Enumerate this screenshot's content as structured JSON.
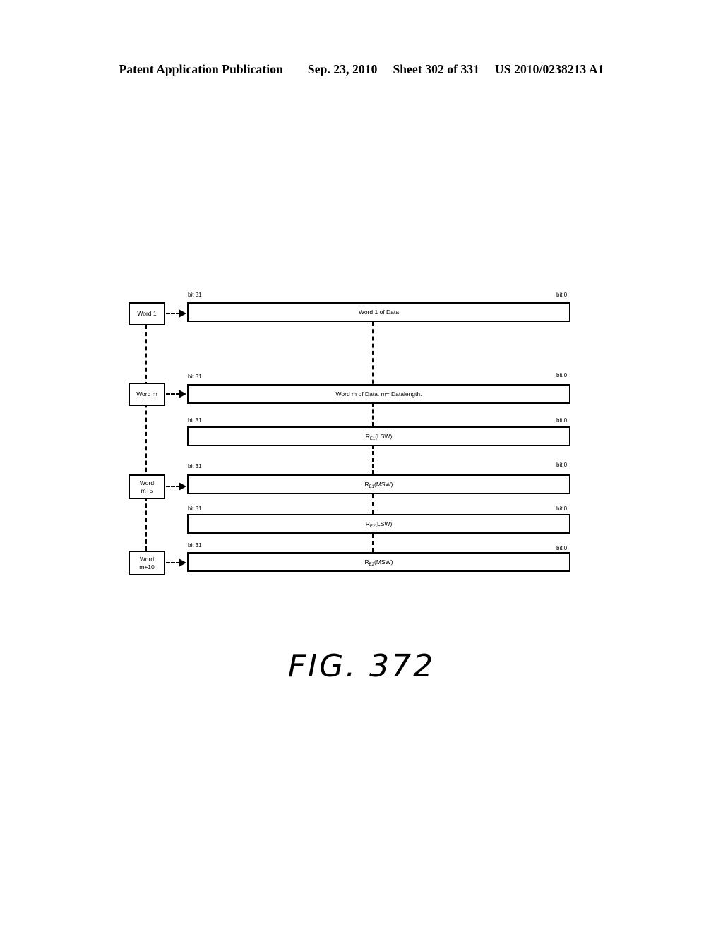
{
  "header": {
    "publication": "Patent Application Publication",
    "date": "Sep. 23, 2010",
    "sheet": "Sheet 302 of 331",
    "patent_number": "US 2010/0238213 A1"
  },
  "figure": {
    "caption": "FIG. 372",
    "bit_label_left": "bit 31",
    "bit_label_right": "bit 0",
    "word_boxes": [
      {
        "line1": "Word 1",
        "line2": ""
      },
      {
        "line1": "Word m",
        "line2": ""
      },
      {
        "line1": "Word",
        "line2": "m+5"
      },
      {
        "line1": "Word",
        "line2": "m+10"
      }
    ],
    "bars": [
      {
        "text": "Word 1  of Data",
        "sub": ""
      },
      {
        "text": "Word m of Data.  m= Datalength.",
        "sub": ""
      },
      {
        "base": "R",
        "sub": "E1",
        "suffix": "(LSW)"
      },
      {
        "base": "R",
        "sub": "E1",
        "suffix": "(MSW)"
      },
      {
        "base": "R",
        "sub": "E2",
        "suffix": "(LSW)"
      },
      {
        "base": "R",
        "sub": "E2",
        "suffix": "(MSW)"
      }
    ]
  }
}
